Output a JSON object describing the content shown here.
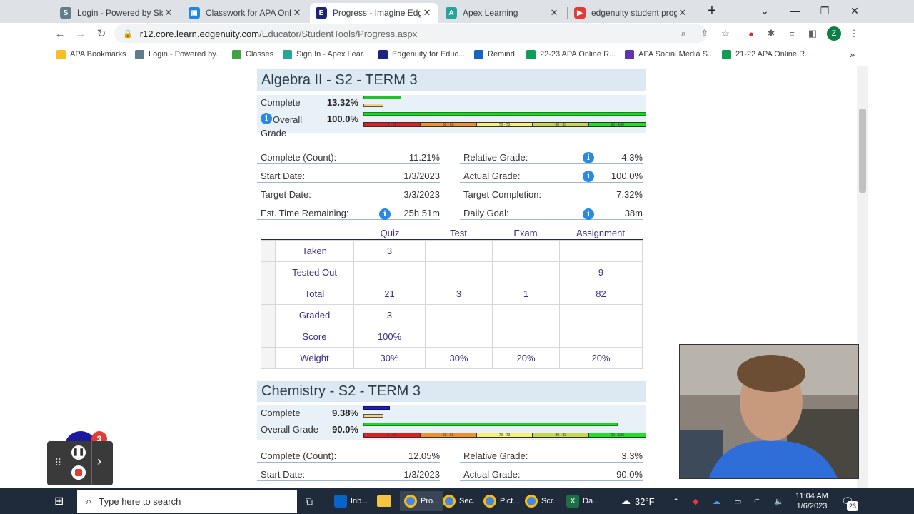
{
  "browser": {
    "tabs": [
      {
        "label": "Login - Powered by Skyw",
        "icon_color": "#607d8b"
      },
      {
        "label": "Classwork for APA Online",
        "icon_color": "#1e88e5"
      },
      {
        "label": "Progress - Imagine Edge",
        "icon_color": "#1a237e"
      },
      {
        "label": "Apex Learning",
        "icon_color": "#26a69a"
      },
      {
        "label": "edgenuity student progre",
        "icon_color": "#e53935"
      }
    ],
    "new_tab": "+",
    "url_host": "r12.core.learn.edgenuity.com",
    "url_path": "/Educator/StudentTools/Progress.aspx",
    "avatar_letter": "Z"
  },
  "bookmarks": [
    {
      "label": "APA Bookmarks",
      "color": "#f6bf26"
    },
    {
      "label": "Login - Powered by...",
      "color": "#607d8b"
    },
    {
      "label": "Classes",
      "color": "#43a047"
    },
    {
      "label": "Sign In - Apex Lear...",
      "color": "#26a69a"
    },
    {
      "label": "Edgenuity for Educ...",
      "color": "#1a237e"
    },
    {
      "label": "Remind",
      "color": "#1565c0"
    },
    {
      "label": "22-23 APA Online R...",
      "color": "#0f9d58"
    },
    {
      "label": "APA Social Media S...",
      "color": "#5e35b1"
    },
    {
      "label": "21-22 APA Online R...",
      "color": "#0f9d58"
    }
  ],
  "course1": {
    "title": "Algebra II - S2 - TERM 3",
    "complete_label": "Complete",
    "complete_pct": "13.32%",
    "complete_fraction": 0.1332,
    "overall_label": "Overall",
    "overall_label2": "Grade",
    "overall_pct": "100.0%",
    "overall_fraction": 1.0,
    "grade_bands": [
      "0 - 59",
      "60 - 63",
      "70 - 73",
      "80 - 83",
      "90 - 100"
    ],
    "stats_left": [
      {
        "label": "Complete (Count):",
        "value": "11.21%"
      },
      {
        "label": "Start Date:",
        "value": "1/3/2023"
      },
      {
        "label": "Target Date:",
        "value": "3/3/2023"
      },
      {
        "label": "Est. Time Remaining:",
        "value": "25h 51m"
      }
    ],
    "stats_right": [
      {
        "label": "Relative Grade:",
        "value": "4.3%"
      },
      {
        "label": "Actual Grade:",
        "value": "100.0%"
      },
      {
        "label": "Target Completion:",
        "value": "7.32%"
      },
      {
        "label": "Daily Goal:",
        "value": "38m"
      }
    ],
    "columns": [
      "Quiz",
      "Test",
      "Exam",
      "Assignment"
    ],
    "rows": [
      {
        "label": "Taken",
        "cells": [
          "3",
          "",
          "",
          ""
        ]
      },
      {
        "label": "Tested Out",
        "cells": [
          "",
          "",
          "",
          "9"
        ]
      },
      {
        "label": "Total",
        "cells": [
          "21",
          "3",
          "1",
          "82"
        ]
      },
      {
        "label": "Graded",
        "cells": [
          "3",
          "",
          "",
          ""
        ]
      },
      {
        "label": "Score",
        "cells": [
          "100%",
          "",
          "",
          ""
        ]
      },
      {
        "label": "Weight",
        "cells": [
          "30%",
          "30%",
          "20%",
          "20%"
        ]
      }
    ]
  },
  "course2": {
    "title": "Chemistry - S2 - TERM 3",
    "complete_label": "Complete",
    "complete_pct": "9.38%",
    "complete_fraction": 0.0938,
    "overall_label": "Overall Grade",
    "overall_pct": "90.0%",
    "overall_fraction": 0.9,
    "grade_bands": [
      "0 - 59",
      "60 - 63",
      "70 - 73",
      "80 - 83",
      "90 - 100"
    ],
    "stats_left": [
      {
        "label": "Complete (Count):",
        "value": "12.05%"
      },
      {
        "label": "Start Date:",
        "value": "1/3/2023"
      }
    ],
    "stats_right": [
      {
        "label": "Relative Grade:",
        "value": "3.3%"
      },
      {
        "label": "Actual Grade:",
        "value": "90.0%"
      }
    ]
  },
  "taskbar": {
    "search_placeholder": "Type here to search",
    "apps": [
      "Inb...",
      "Pro...",
      "Sec...",
      "Pict...",
      "Scr...",
      "Da..."
    ],
    "weather": "32°F",
    "time": "11:04 AM",
    "date": "1/6/2023",
    "notif_count": "23"
  },
  "recorder": {
    "badge": "3"
  }
}
